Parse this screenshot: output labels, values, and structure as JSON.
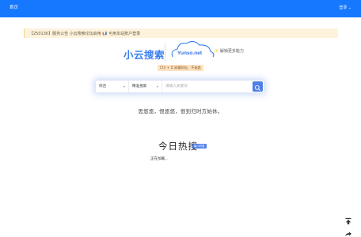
{
  "header": {
    "home_label": "首页",
    "login_label": "登录 ⌄",
    "background_color": "#1677ff"
  },
  "notice": {
    "text": "【250130】服务公告 小云搜索论坛启用 📢 可用本站账户登录"
  },
  "brand": {
    "name": "小云搜索",
    "logo_text": "Yunso.net",
    "accent_color": "#3a7ff0",
    "more_power": "✨ 解锁更多能力"
  },
  "shortcut_hint": "Ctrl + D 收藏网址，不迷路",
  "search": {
    "scope_value": "综合",
    "mode_value": "精准搜索",
    "placeholder": "请输入关键词",
    "button_icon": "search-icon"
  },
  "slogan": "思悠悠，恨悠悠，恨到归时方始休。",
  "hot": {
    "title": "今日热搜",
    "badge": "每小时更",
    "loading_text": "正在加载..."
  },
  "floating": {
    "to_top_icon": "arrow-up-to-line-icon",
    "share_icon": "share-icon"
  }
}
